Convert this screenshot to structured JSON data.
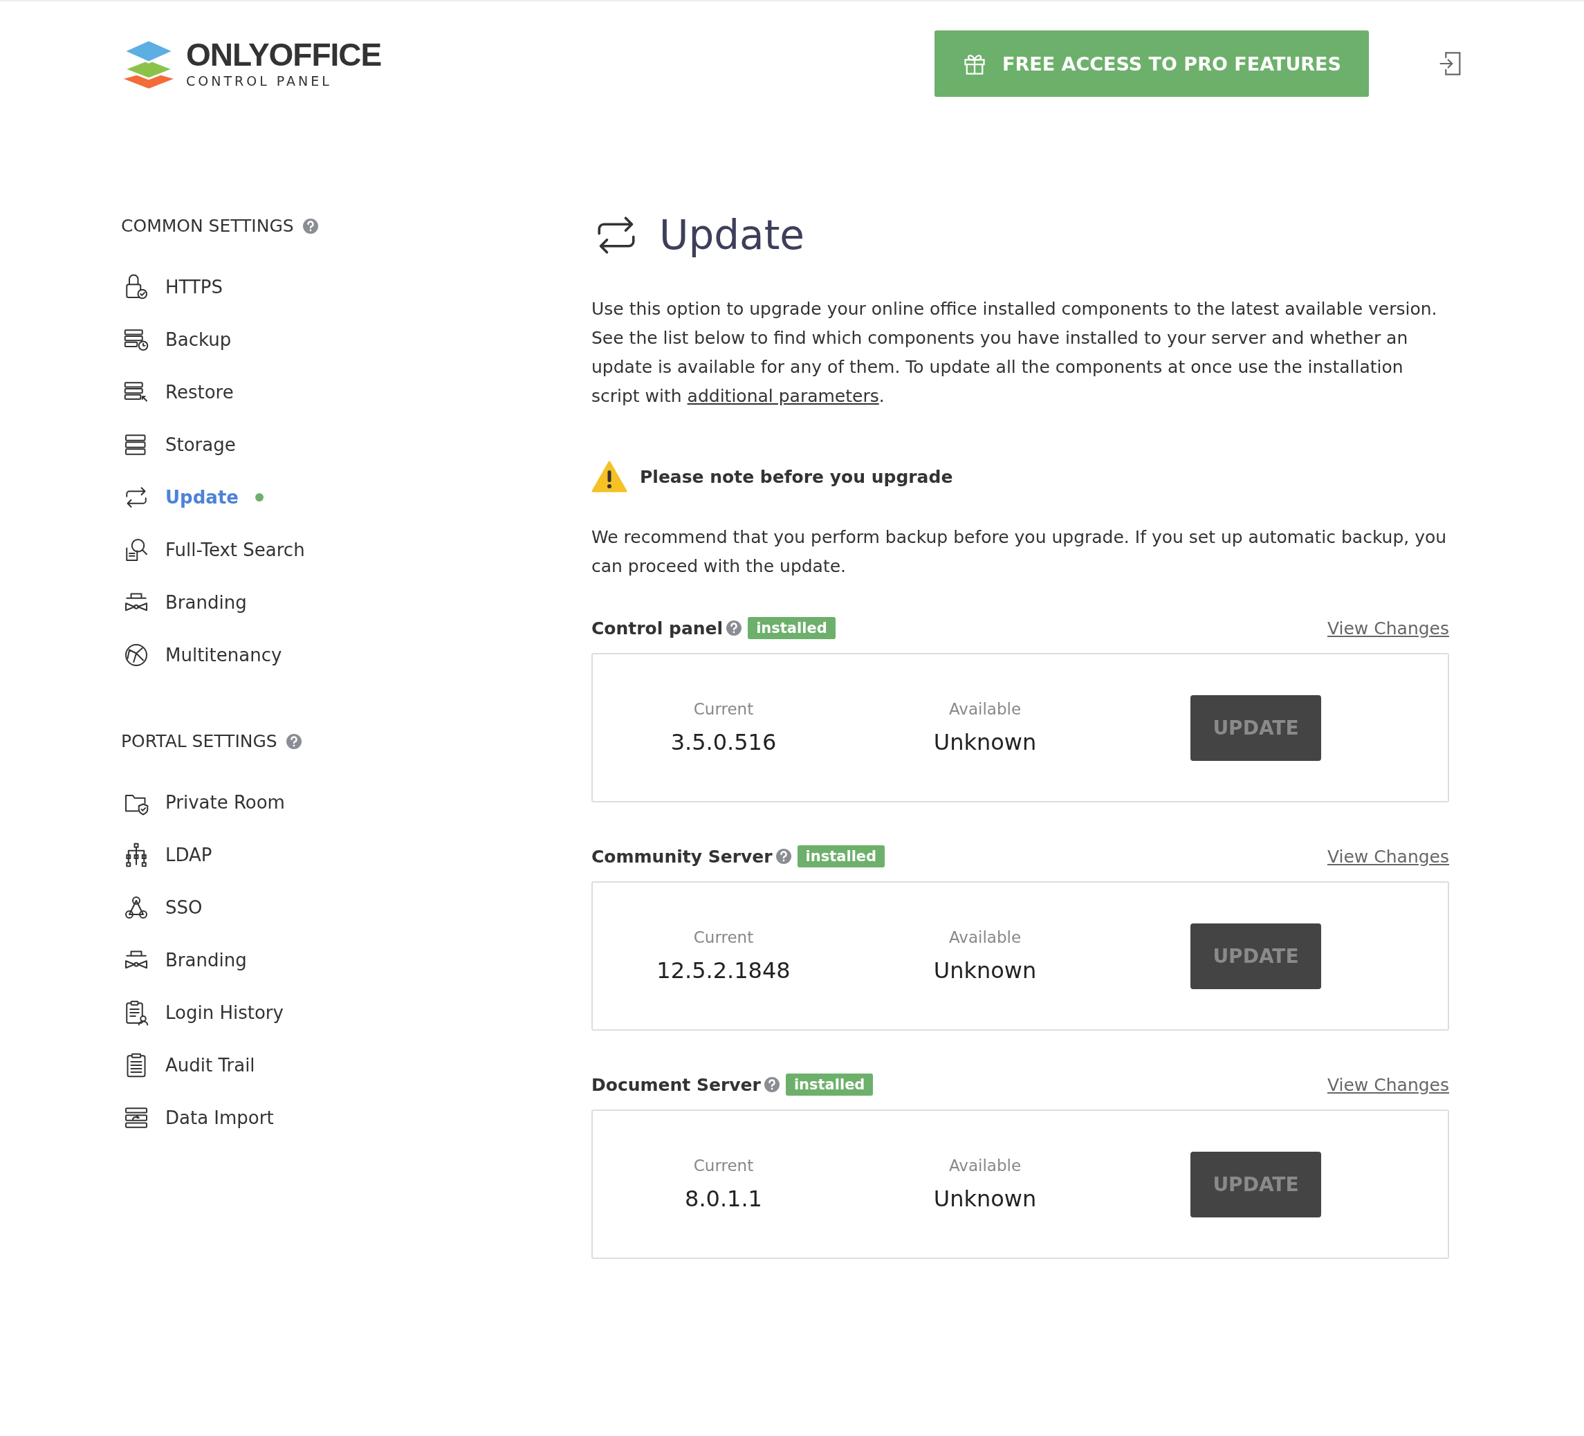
{
  "header": {
    "logo_name": "ONLYOFFICE",
    "logo_sub": "CONTROL PANEL",
    "promo_button": "FREE ACCESS TO PRO FEATURES"
  },
  "sidebar": {
    "sections": [
      {
        "title": "COMMON SETTINGS",
        "items": [
          {
            "label": "HTTPS",
            "selected": false,
            "dot": false
          },
          {
            "label": "Backup",
            "selected": false,
            "dot": false
          },
          {
            "label": "Restore",
            "selected": false,
            "dot": false
          },
          {
            "label": "Storage",
            "selected": false,
            "dot": false
          },
          {
            "label": "Update",
            "selected": true,
            "dot": true
          },
          {
            "label": "Full-Text Search",
            "selected": false,
            "dot": false
          },
          {
            "label": "Branding",
            "selected": false,
            "dot": false
          },
          {
            "label": "Multitenancy",
            "selected": false,
            "dot": false
          }
        ]
      },
      {
        "title": "PORTAL SETTINGS",
        "items": [
          {
            "label": "Private Room",
            "selected": false,
            "dot": false
          },
          {
            "label": "LDAP",
            "selected": false,
            "dot": false
          },
          {
            "label": "SSO",
            "selected": false,
            "dot": false
          },
          {
            "label": "Branding",
            "selected": false,
            "dot": false
          },
          {
            "label": "Login History",
            "selected": false,
            "dot": false
          },
          {
            "label": "Audit Trail",
            "selected": false,
            "dot": false
          },
          {
            "label": "Data Import",
            "selected": false,
            "dot": false
          }
        ]
      }
    ]
  },
  "content": {
    "title": "Update",
    "description": {
      "text": "Use this option to upgrade your online office installed components to the latest available version. See the list below to find which components you have installed to your server and whether an update is available for any of them. To update all the components at once use the installation script with",
      "link": "additional parameters",
      "after": "."
    },
    "warning": {
      "title": "Please note before you upgrade",
      "text": "We recommend that you perform backup before you upgrade. If you set up automatic backup, you can proceed with the update."
    },
    "components": [
      {
        "name": "Control panel",
        "badge": "installed",
        "link": "View Changes",
        "current_label": "Current",
        "current": "3.5.0.516",
        "available_label": "Available",
        "available": "Unknown",
        "button": "UPDATE",
        "disabled": true
      },
      {
        "name": "Community Server",
        "badge": "installed",
        "link": "View Changes",
        "current_label": "Current",
        "current": "12.5.2.1848",
        "available_label": "Available",
        "available": "Unknown",
        "button": "UPDATE",
        "disabled": true
      },
      {
        "name": "Document Server",
        "badge": "installed",
        "link": "View Changes",
        "current_label": "Current",
        "current": "8.0.1.1",
        "available_label": "Available",
        "available": "Unknown",
        "button": "UPDATE",
        "disabled": true
      }
    ]
  }
}
